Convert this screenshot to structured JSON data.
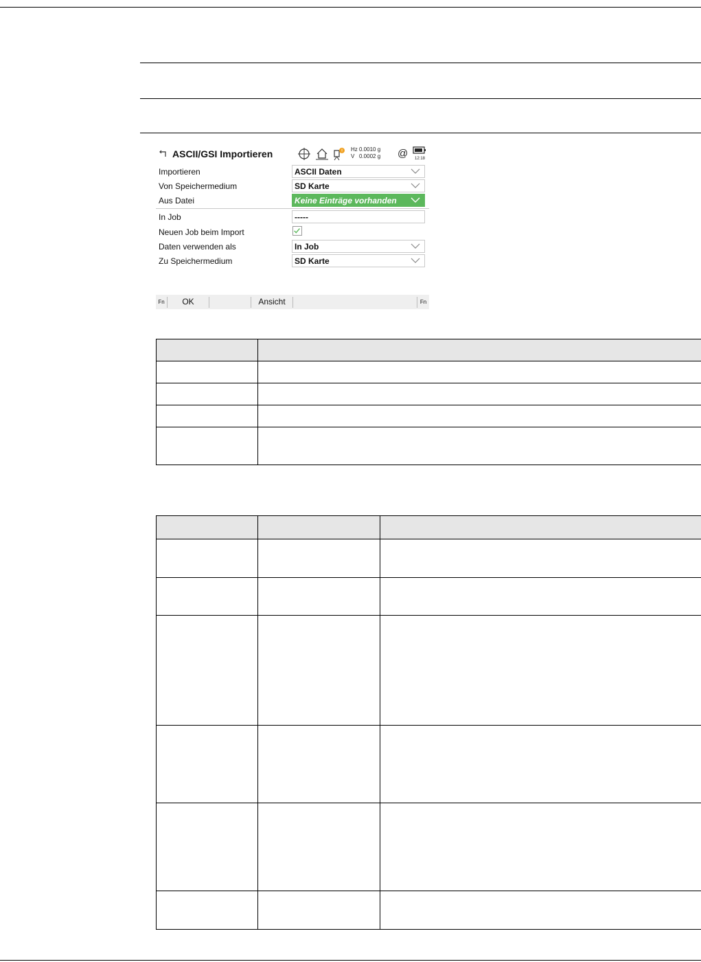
{
  "screen": {
    "title": "ASCII/GSI Importieren",
    "status": {
      "hz_line": "Hz 0.0010 g",
      "v_line": "V   0.0002 g",
      "time": "12:18",
      "at_symbol": "@"
    },
    "fields": [
      {
        "label": "Importieren",
        "value": "ASCII Daten",
        "type": "dropdown"
      },
      {
        "label": "Von Speichermedium",
        "value": "SD Karte",
        "type": "dropdown"
      },
      {
        "label": "Aus Datei",
        "value": "Keine Einträge vorhanden",
        "type": "dropdown",
        "highlight": "#5cb85c"
      },
      {
        "label": "In Job",
        "value": "-----",
        "type": "text"
      },
      {
        "label": "Neuen Job beim Import",
        "value": "checked",
        "type": "checkbox"
      },
      {
        "label": "Daten verwenden als",
        "value": "In Job",
        "type": "dropdown"
      },
      {
        "label": "Zu Speichermedium",
        "value": "SD Karte",
        "type": "dropdown"
      }
    ],
    "softkeys": {
      "fn_left": "Fn",
      "ok": "OK",
      "ansicht": "Ansicht",
      "fn_right": "Fn"
    },
    "icons": [
      "back-icon",
      "crosshair-icon",
      "home-icon",
      "instrument-warning-icon",
      "at-icon",
      "battery-icon",
      "chevron-down-icon",
      "checkmark-icon"
    ],
    "colors": {
      "highlight_green": "#5cb85c",
      "table_header": "#e6e6e6"
    }
  },
  "tables": {
    "table1": {
      "columns": 2,
      "rows": 5
    },
    "table2": {
      "columns": 3,
      "rows": 7
    }
  }
}
